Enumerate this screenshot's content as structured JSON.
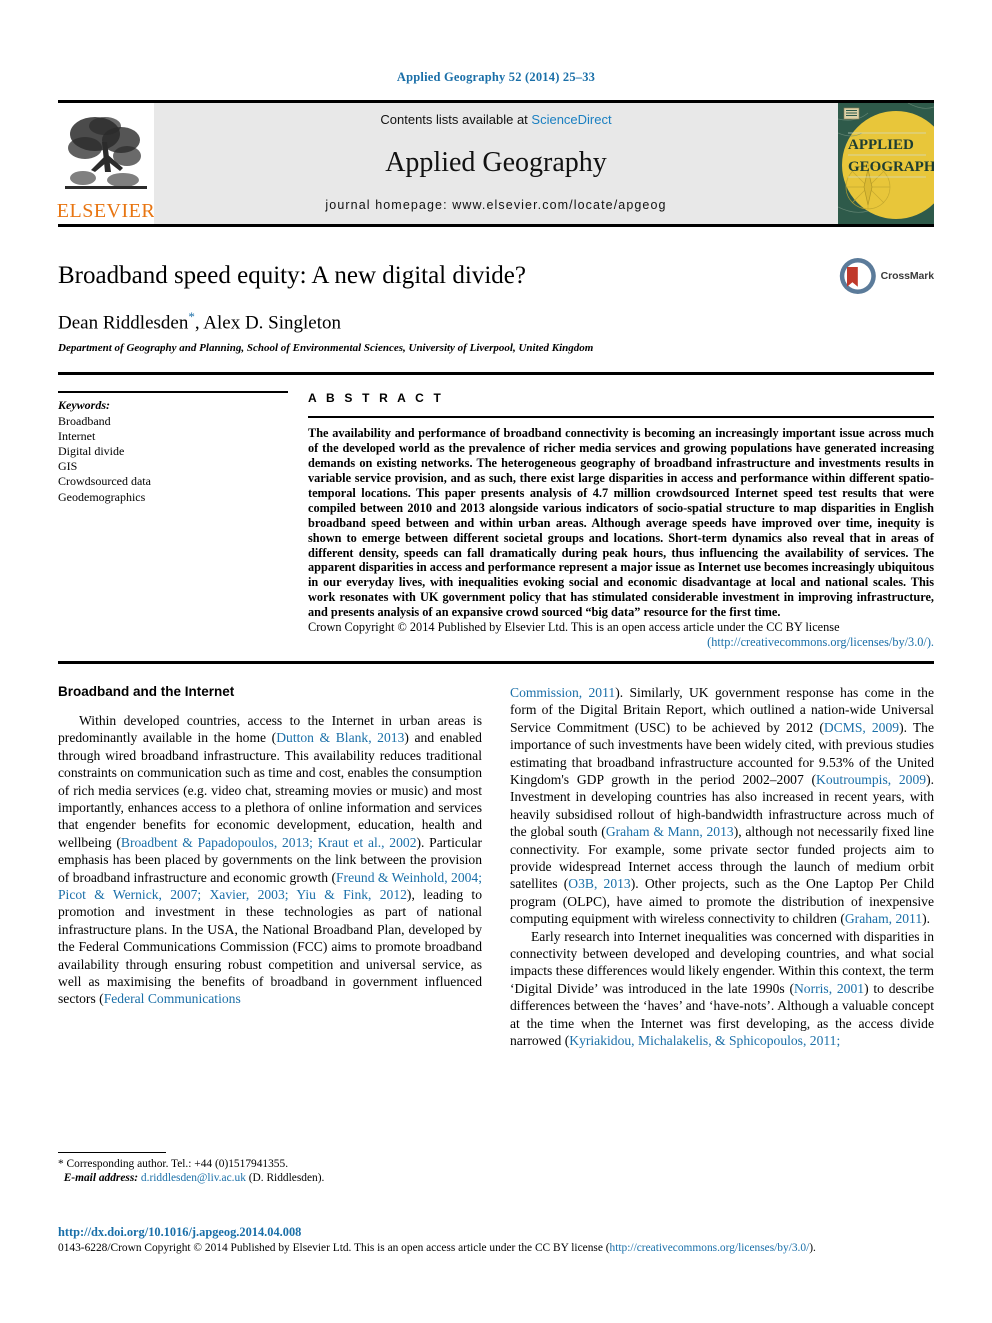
{
  "running_head": "Applied Geography 52 (2014) 25–33",
  "masthead": {
    "contents_prefix": "Contents lists available at ",
    "sciencedirect": "ScienceDirect",
    "journal_name": "Applied Geography",
    "homepage": "journal homepage: www.elsevier.com/locate/apgeog",
    "publisher_name": "ELSEVIER",
    "cover_line1": "APPLIED",
    "cover_line2": "GEOGRAPHY"
  },
  "article": {
    "title": "Broadband speed equity: A new digital divide?",
    "authors": "Dean Riddlesden",
    "author_star": "*",
    "authors_rest": ", Alex D. Singleton",
    "affiliation": "Department of Geography and Planning, School of Environmental Sciences, University of Liverpool, United Kingdom",
    "crossmark_label": "CrossMark"
  },
  "keywords": {
    "heading": "Keywords:",
    "items": [
      "Broadband",
      "Internet",
      "Digital divide",
      "GIS",
      "Crowdsourced data",
      "Geodemographics"
    ]
  },
  "abstract": {
    "heading": "A B S T R A C T",
    "text": "The availability and performance of broadband connectivity is becoming an increasingly important issue across much of the developed world as the prevalence of richer media services and growing populations have generated increasing demands on existing networks. The heterogeneous geography of broadband infrastructure and investments results in variable service provision, and as such, there exist large disparities in access and performance within different spatio-temporal locations. This paper presents analysis of 4.7 million crowdsourced Internet speed test results that were compiled between 2010 and 2013 alongside various indicators of socio-spatial structure to map disparities in English broadband speed between and within urban areas. Although average speeds have improved over time, inequity is shown to emerge between different societal groups and locations. Short-term dynamics also reveal that in areas of different density, speeds can fall dramatically during peak hours, thus influencing the availability of services. The apparent disparities in access and performance represent a major issue as Internet use becomes increasingly ubiquitous in our everyday lives, with inequalities evoking social and economic disadvantage at local and national scales. This work resonates with UK government policy that has stimulated considerable investment in improving infrastructure, and presents analysis of an expansive crowd sourced “big data” resource for the first time.",
    "copyright": "Crown Copyright © 2014 Published by Elsevier Ltd. This is an open access article under the CC BY license",
    "license_url": "(http://creativecommons.org/licenses/by/3.0/)."
  },
  "body": {
    "section_heading": "Broadband and the Internet",
    "left_col": {
      "p1_a": "Within developed countries, access to the Internet in urban areas is predominantly available in the home (",
      "p1_cite1": "Dutton & Blank, 2013",
      "p1_b": ") and enabled through wired broadband infrastructure. This availability reduces traditional constraints on communication such as time and cost, enables the consumption of rich media services (e.g. video chat, streaming movies or music) and most importantly, enhances access to a plethora of online information and services that engender benefits for economic development, education, health and wellbeing (",
      "p1_cite2": "Broadbent & Papadopoulos, 2013; Kraut et al., 2002",
      "p1_c": "). Particular emphasis has been placed by governments on the link between the provision of broadband infrastructure and economic growth (",
      "p1_cite3": "Freund & Weinhold, 2004; Picot & Wernick, 2007; Xavier, 2003; Yiu & Fink, 2012",
      "p1_d": "), leading to promotion and investment in these technologies as part of national infrastructure plans. In the USA, the National Broadband Plan, developed by the Federal Communications Commission (FCC) aims to promote broadband availability through ensuring robust competition and universal service, as well as maximising the benefits of broadband in government influenced sectors (",
      "p1_cite4": "Federal Communications"
    },
    "right_col": {
      "p1_cite_cont": "Commission, 2011",
      "p1_e": "). Similarly, UK government response has come in the form of the Digital Britain Report, which outlined a nation-wide Universal Service Commitment (USC) to be achieved by 2012 (",
      "p1_cite5": "DCMS, 2009",
      "p1_f": "). The importance of such investments have been widely cited, with previous studies estimating that broadband infrastructure accounted for 9.53% of the United Kingdom's GDP growth in the period 2002–2007 (",
      "p1_cite6": "Koutroumpis, 2009",
      "p1_g": "). Investment in developing countries has also increased in recent years, with heavily subsidised rollout of high-bandwidth infrastructure across much of the global south (",
      "p1_cite7": "Graham & Mann, 2013",
      "p1_h": "), although not necessarily fixed line connectivity. For example, some private sector funded projects aim to provide widespread Internet access through the launch of medium orbit satellites (",
      "p1_cite8": "O3B, 2013",
      "p1_i": "). Other projects, such as the One Laptop Per Child program (OLPC), have aimed to promote the distribution of inexpensive computing equipment with wireless connectivity to children (",
      "p1_cite9": "Graham, 2011",
      "p1_j": ").",
      "p2_a": "Early research into Internet inequalities was concerned with disparities in connectivity between developed and developing countries, and what social impacts these differences would likely engender. Within this context, the term ‘Digital Divide’ was introduced in the late 1990s (",
      "p2_cite1": "Norris, 2001",
      "p2_b": ") to describe differences between the ‘haves’ and ‘have-nots’. Although a valuable concept at the time when the Internet was first developing, as the access divide narrowed (",
      "p2_cite2": "Kyriakidou, Michalakelis, & Sphicopoulos, 2011;"
    }
  },
  "footnotes": {
    "corresponding": "* Corresponding author. Tel.: +44 (0)1517941355.",
    "email_label": "E-mail address:",
    "email": "d.riddlesden@liv.ac.uk",
    "email_suffix": "(D. Riddlesden)."
  },
  "footer": {
    "doi": "http://dx.doi.org/10.1016/j.apgeog.2014.04.008",
    "issn_text": "0143-6228/Crown Copyright © 2014 Published by Elsevier Ltd. This is an open access article under the CC BY license (",
    "issn_link": "http://creativecommons.org/licenses/by/3.0/",
    "issn_tail": ")."
  },
  "colors": {
    "link": "#1a6fa8",
    "elsevier_orange": "#e87511",
    "masthead_bg": "#e8e8e8",
    "cover_green": "#2e5a4a",
    "cover_yellow": "#e8c63a",
    "crossmark_red": "#c0392b",
    "crossmark_blue": "#5b7b9a"
  }
}
